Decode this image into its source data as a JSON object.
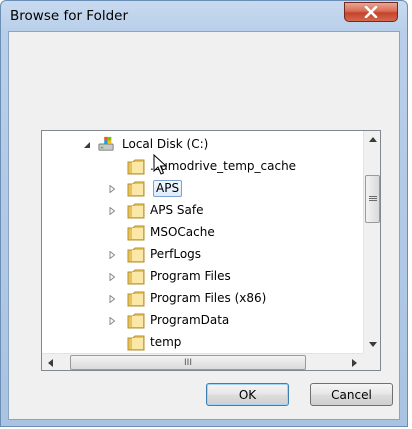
{
  "window": {
    "title": "Browse for Folder"
  },
  "tree": {
    "root": {
      "label": "Local Disk (C:)",
      "icon": "drive-icon"
    },
    "items": [
      {
        "label": ".zumodrive_temp_cache",
        "has_children": false
      },
      {
        "label": "APS",
        "has_children": true,
        "selected": true
      },
      {
        "label": "APS Safe",
        "has_children": true
      },
      {
        "label": "MSOCache",
        "has_children": false
      },
      {
        "label": "PerfLogs",
        "has_children": true
      },
      {
        "label": "Program Files",
        "has_children": true
      },
      {
        "label": "Program Files (x86)",
        "has_children": true
      },
      {
        "label": "ProgramData",
        "has_children": true
      },
      {
        "label": "temp",
        "has_children": false
      }
    ],
    "hscroll_grip": "III"
  },
  "buttons": {
    "ok": "OK",
    "cancel": "Cancel"
  },
  "colors": {
    "folder": "#e8c35a",
    "selection_border": "#7da2ce",
    "close_button": "#c5432a"
  }
}
